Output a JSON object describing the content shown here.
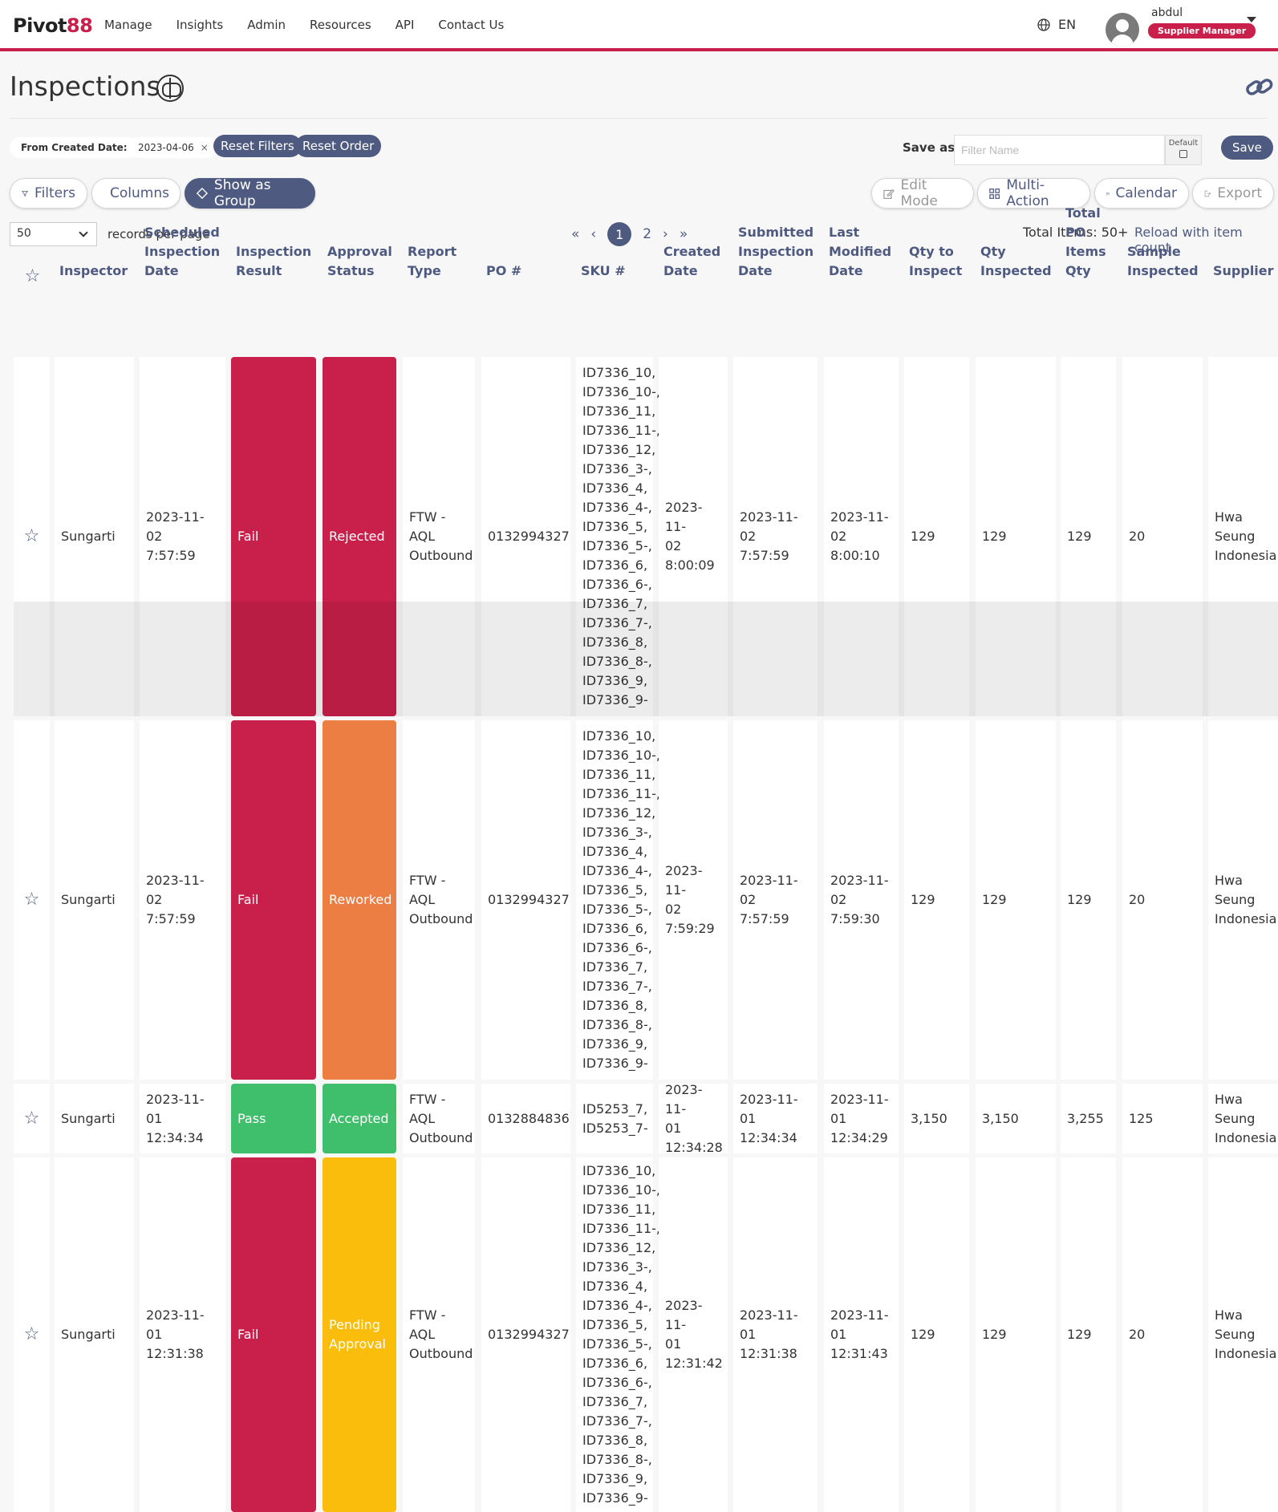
{
  "nav": {
    "logo_a": "Pivot",
    "logo_b": "88",
    "items": [
      "Manage",
      "Insights",
      "Admin",
      "Resources",
      "API",
      "Contact Us"
    ],
    "lang": "EN",
    "user": "abdul",
    "role": "Supplier Manager"
  },
  "page": {
    "title": "Inspections"
  },
  "filters": {
    "from_label": "From Created Date:",
    "from_value": "2023-04-06",
    "reset_filters": "Reset Filters",
    "reset_order": "Reset Order",
    "save_as": "Save as",
    "filter_placeholder": "Filter Name",
    "default_label": "Default",
    "save": "Save"
  },
  "toolbar": {
    "filters": "Filters",
    "columns": "Columns",
    "show_as_group": "Show as Group",
    "edit_mode": "Edit Mode",
    "multi_action": "Multi-Action",
    "calendar": "Calendar",
    "export": "Export"
  },
  "paging": {
    "per_page": "50",
    "per_page_label": "records per page",
    "pages": [
      "1",
      "2"
    ],
    "current_page": "1",
    "total": "Total Items: 50+",
    "reload": "Reload with item count"
  },
  "table": {
    "headers": [
      "Inspector",
      "Scheduled Inspection Date",
      "Inspection Result",
      "Approval Status",
      "Report Type",
      "PO #",
      "SKU #",
      "Created Date",
      "Submitted Inspection Date",
      "Last Modified Date",
      "Qty to Inspect",
      "Qty Inspected",
      "Total PO Items Qty",
      "Sample Inspected",
      "Supplier"
    ],
    "rows": [
      {
        "inspector": "Sungarti",
        "scheduled": [
          "2023-11-02",
          "7:57:59"
        ],
        "result": "Fail",
        "approval": "Rejected",
        "report": [
          "FTW - AQL",
          "Outbound"
        ],
        "po": "0132994327",
        "sku": [
          "ID7336_10,",
          "ID7336_10-,",
          "ID7336_11,",
          "ID7336_11-,",
          "ID7336_12,",
          "ID7336_3-,",
          "ID7336_4,",
          "ID7336_4-,",
          "ID7336_5,",
          "ID7336_5-,",
          "ID7336_6,",
          "ID7336_6-,",
          "ID7336_7,",
          "ID7336_7-,",
          "ID7336_8,",
          "ID7336_8-,",
          "ID7336_9,",
          "ID7336_9-"
        ],
        "created": [
          "2023-11-",
          "02",
          "8:00:09"
        ],
        "submitted": [
          "2023-11-02",
          "7:57:59"
        ],
        "modified": [
          "2023-11-",
          "02 8:00:10"
        ],
        "qty_inspect": "129",
        "qty_inspected": "129",
        "total_po": "129",
        "sample": "20",
        "supplier": [
          "Hwa",
          "Seung",
          "Indonesia"
        ]
      },
      {
        "inspector": "Sungarti",
        "scheduled": [
          "2023-11-02",
          "7:57:59"
        ],
        "result": "Fail",
        "approval": "Reworked",
        "report": [
          "FTW - AQL",
          "Outbound"
        ],
        "po": "0132994327",
        "sku": [
          "ID7336_10,",
          "ID7336_10-,",
          "ID7336_11,",
          "ID7336_11-,",
          "ID7336_12,",
          "ID7336_3-,",
          "ID7336_4,",
          "ID7336_4-,",
          "ID7336_5,",
          "ID7336_5-,",
          "ID7336_6,",
          "ID7336_6-,",
          "ID7336_7,",
          "ID7336_7-,",
          "ID7336_8,",
          "ID7336_8-,",
          "ID7336_9,",
          "ID7336_9-"
        ],
        "created": [
          "2023-11-",
          "02",
          "7:59:29"
        ],
        "submitted": [
          "2023-11-02",
          "7:57:59"
        ],
        "modified": [
          "2023-11-",
          "02 7:59:30"
        ],
        "qty_inspect": "129",
        "qty_inspected": "129",
        "total_po": "129",
        "sample": "20",
        "supplier": [
          "Hwa",
          "Seung",
          "Indonesia"
        ]
      },
      {
        "inspector": "Sungarti",
        "scheduled": [
          "2023-11-01",
          "12:34:34"
        ],
        "result": "Pass",
        "approval": "Accepted",
        "report": [
          "FTW - AQL",
          "Outbound"
        ],
        "po": "0132884836",
        "sku": [
          "ID5253_7,",
          "ID5253_7-"
        ],
        "created": [
          "2023-11-",
          "01",
          "12:34:28"
        ],
        "submitted": [
          "2023-11-01",
          "12:34:34"
        ],
        "modified": [
          "2023-11-",
          "01",
          "12:34:29"
        ],
        "qty_inspect": "3,150",
        "qty_inspected": "3,150",
        "total_po": "3,255",
        "sample": "125",
        "supplier": [
          "Hwa",
          "Seung",
          "Indonesia"
        ]
      },
      {
        "inspector": "Sungarti",
        "scheduled": [
          "2023-11-01",
          "12:31:38"
        ],
        "result": "Fail",
        "approval": "Pending Approval",
        "report": [
          "FTW - AQL",
          "Outbound"
        ],
        "po": "0132994327",
        "sku": [
          "ID7336_10,",
          "ID7336_10-,",
          "ID7336_11,",
          "ID7336_11-,",
          "ID7336_12,",
          "ID7336_3-,",
          "ID7336_4,",
          "ID7336_4-,",
          "ID7336_5,",
          "ID7336_5-,",
          "ID7336_6,",
          "ID7336_6-,",
          "ID7336_7,",
          "ID7336_7-,",
          "ID7336_8,",
          "ID7336_8-,",
          "ID7336_9,",
          "ID7336_9-"
        ],
        "created": [
          "2023-11-",
          "01",
          "12:31:42"
        ],
        "submitted": [
          "2023-11-01",
          "12:31:38"
        ],
        "modified": [
          "2023-11-",
          "01",
          "12:31:43"
        ],
        "qty_inspect": "129",
        "qty_inspected": "129",
        "total_po": "129",
        "sample": "20",
        "supplier": [
          "Hwa",
          "Seung",
          "Indonesia"
        ]
      }
    ],
    "colors": {
      "Fail": "#c8204a",
      "Pass": "#3fbf6c",
      "Rejected": "#c8204a",
      "Reworked": "#ed7e43",
      "Accepted": "#3fbf6c",
      "Pending Approval": "#fbbd0b"
    }
  },
  "icons": [
    "globe-icon",
    "user-avatar-icon",
    "caret-down-icon",
    "brain-icon",
    "link-icon",
    "filter-icon",
    "columns-icon",
    "group-icon",
    "edit-icon",
    "multi-action-icon",
    "calendar-icon",
    "export-icon",
    "star-icon",
    "pager-first-icon",
    "pager-prev-icon",
    "pager-next-icon",
    "pager-last-icon"
  ]
}
